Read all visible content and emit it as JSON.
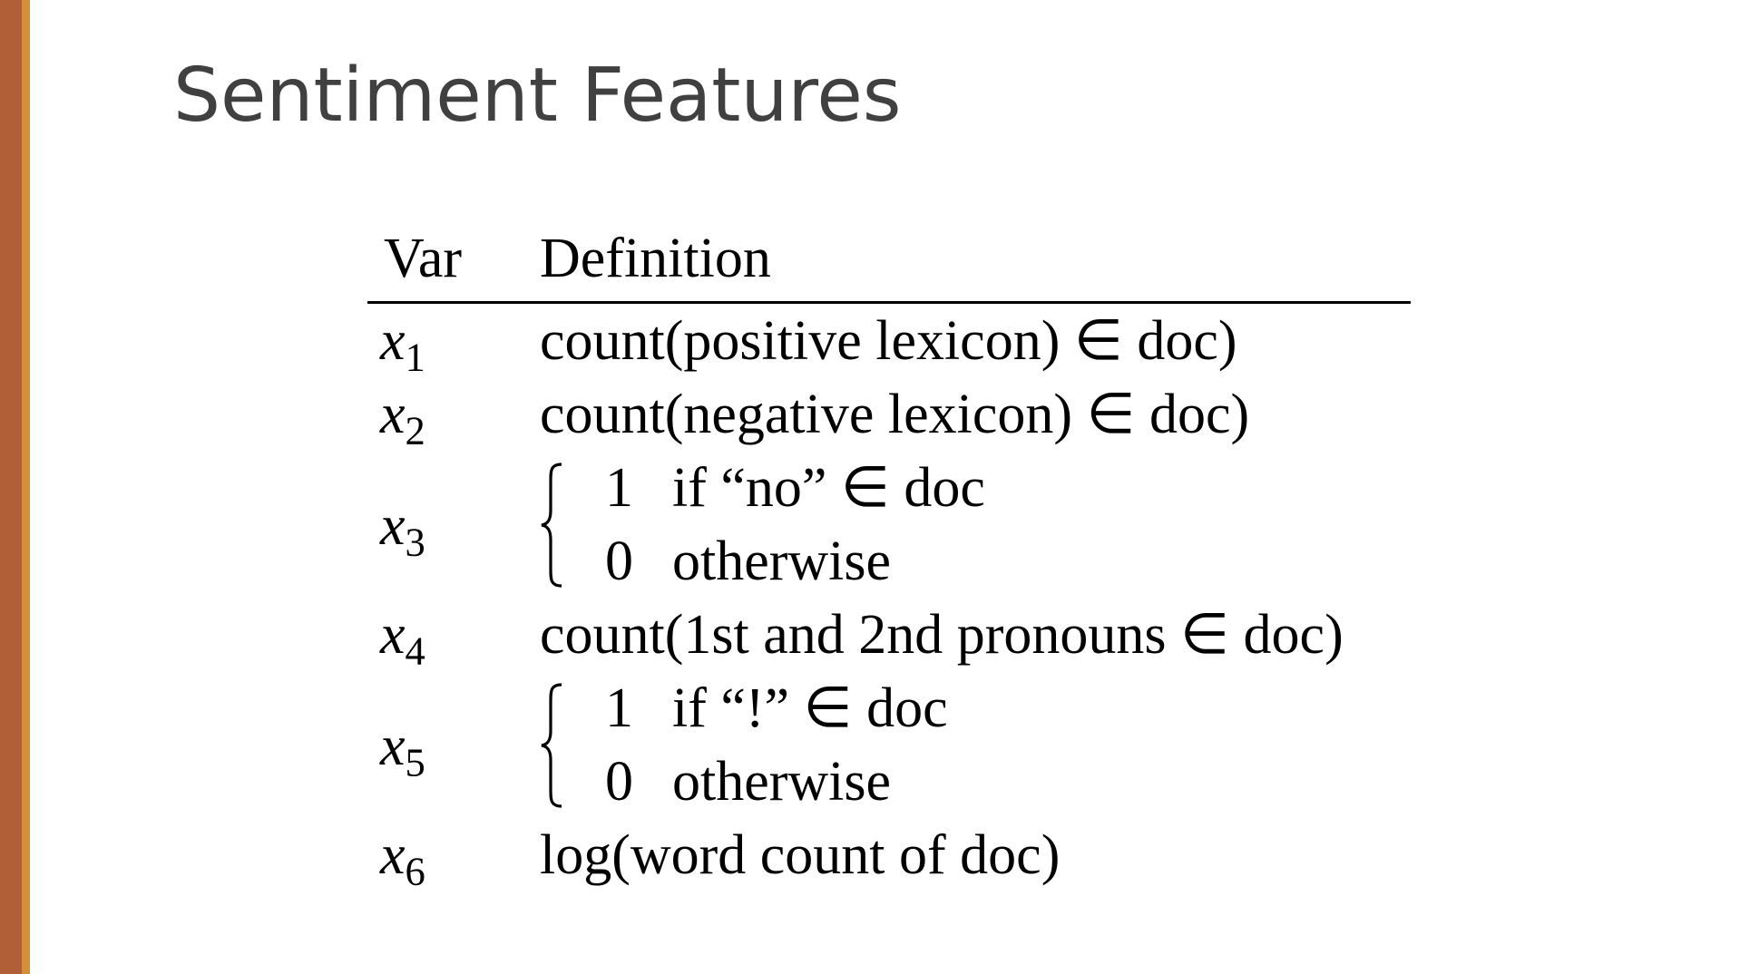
{
  "slide": {
    "title": "Sentiment Features"
  },
  "table": {
    "headers": {
      "var": "Var",
      "definition": "Definition"
    },
    "rows": [
      {
        "var": "x",
        "sub": "1",
        "definition": "count(positive lexicon) ∈ doc)"
      },
      {
        "var": "x",
        "sub": "2",
        "definition": "count(negative lexicon) ∈ doc)"
      },
      {
        "var": "x",
        "sub": "3",
        "cases": [
          {
            "value": "1",
            "condition": "if “no” ∈ doc"
          },
          {
            "value": "0",
            "condition": "otherwise"
          }
        ]
      },
      {
        "var": "x",
        "sub": "4",
        "definition": "count(1st and 2nd pronouns ∈ doc)"
      },
      {
        "var": "x",
        "sub": "5",
        "cases": [
          {
            "value": "1",
            "condition": "if “!” ∈ doc"
          },
          {
            "value": "0",
            "condition": "otherwise"
          }
        ]
      },
      {
        "var": "x",
        "sub": "6",
        "definition": "log(word count of doc)"
      }
    ]
  },
  "colors": {
    "accent_bar": "#b15f37",
    "accent_stripe": "#d58f3c",
    "title_text": "#404040"
  }
}
